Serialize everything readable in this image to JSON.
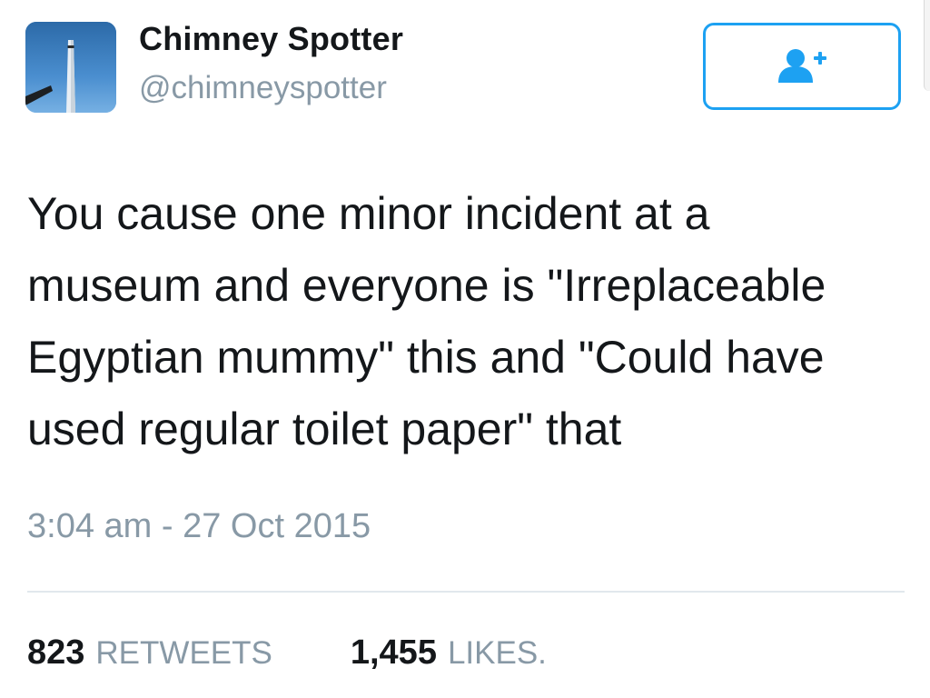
{
  "user": {
    "display_name": "Chimney Spotter",
    "handle": "@chimneyspotter",
    "avatar_icon": "chimney-photo"
  },
  "follow_button": {
    "icon": "add-user-icon",
    "color": "#1da1f2"
  },
  "tweet": {
    "text": "You cause one minor incident at a\nmuseum and everyone is \"Irreplaceable\nEgyptian mummy\" this and \"Could have\nused regular toilet paper\" that",
    "timestamp": "3:04 am - 27 Oct 2015"
  },
  "stats": {
    "retweets_count": "823",
    "retweets_label": "RETWEETS",
    "likes_count": "1,455",
    "likes_label": "LIKES."
  },
  "colors": {
    "text": "#14171a",
    "secondary": "#8899a6",
    "accent": "#1da1f2",
    "divider": "#e1e8ed"
  }
}
